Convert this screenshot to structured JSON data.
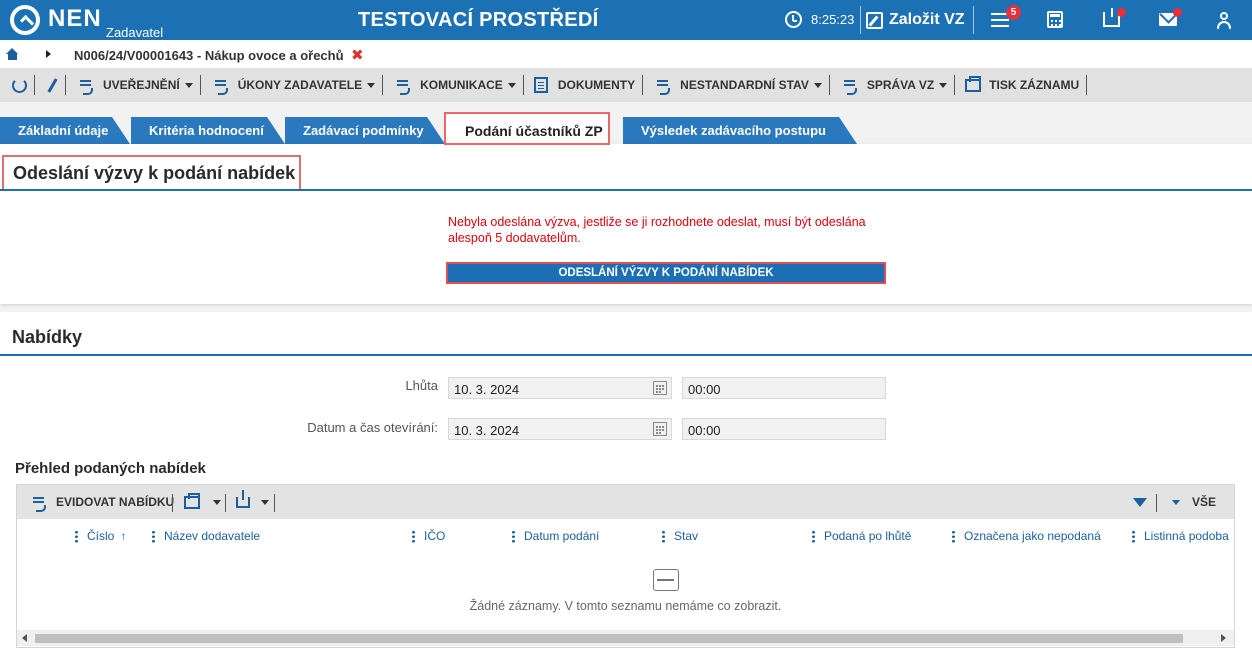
{
  "header": {
    "logo": "NEN",
    "logo_sub": "Zadavatel",
    "environment": "TESTOVACÍ PROSTŘEDÍ",
    "clock": "8:25:23",
    "new_vz": "Založit VZ",
    "notifications_count": "5"
  },
  "breadcrumb": {
    "path": "N006/24/V00001643 - Nákup ovoce a ořechů"
  },
  "toolbar": {
    "uverejneni": "UVEŘEJNĚNÍ",
    "ukony": "ÚKONY ZADAVATELE",
    "komunikace": "KOMUNIKACE",
    "dokumenty": "DOKUMENTY",
    "nestandardni": "NESTANDARDNÍ STAV",
    "sprava": "SPRÁVA VZ",
    "tisk": "TISK ZÁZNAMU"
  },
  "tabs": [
    {
      "label": "Základní údaje"
    },
    {
      "label": "Kritéria hodnocení"
    },
    {
      "label": "Zadávací podmínky"
    },
    {
      "label": "Podání účastníků ZP",
      "active": true
    },
    {
      "label": "Výsledek zadávacího postupu"
    }
  ],
  "invitation": {
    "title": "Odeslání výzvy k podání nabídek",
    "warning": "Nebyla odeslána výzva, jestliže se ji rozhodnete odeslat, musí být odeslána alespoň 5 dodavatelům.",
    "button": "ODESLÁNÍ VÝZVY K PODÁNÍ NABÍDEK"
  },
  "offers": {
    "title": "Nabídky",
    "deadline_label": "Lhůta",
    "deadline_date": "10. 3. 2024",
    "deadline_time": "00:00",
    "opening_label": "Datum a čas otevírání:",
    "opening_date": "10. 3. 2024",
    "opening_time": "00:00",
    "overview_title": "Přehled podaných nabídek",
    "grid": {
      "toolbar_register": "EVIDOVAT NABÍDKU",
      "filter_value": "VŠE",
      "columns": [
        "Číslo",
        "Název dodavatele",
        "IČO",
        "Datum podání",
        "Stav",
        "Podaná po lhůtě",
        "Označena jako nepodaná",
        "Listinná podoba"
      ],
      "sort_indicator": "↑",
      "empty_text": "Žádné záznamy. V tomto seznamu nemáme co zobrazit."
    }
  }
}
